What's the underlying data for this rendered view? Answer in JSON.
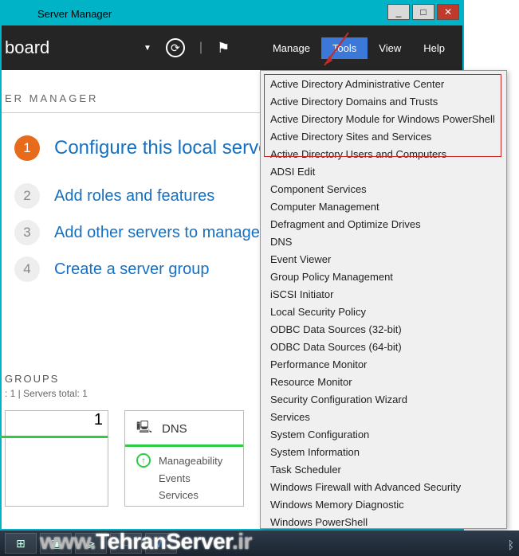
{
  "titlebar": {
    "title": "Server Manager"
  },
  "wincontrols": {
    "min": "_",
    "max": "□",
    "close": "✕"
  },
  "header2": {
    "left_text": "board",
    "menu": {
      "manage": "Manage",
      "tools": "Tools",
      "view": "View",
      "help": "Help"
    }
  },
  "panel": {
    "title": "ER MANAGER"
  },
  "quickstart": {
    "r1": {
      "num": "1",
      "text": "Configure this local server"
    },
    "r2": {
      "num": "2",
      "text": "Add roles and features"
    },
    "r3": {
      "num": "3",
      "text": "Add other servers to manage"
    },
    "r4": {
      "num": "4",
      "text": "Create a server group"
    }
  },
  "groups": {
    "label": "GROUPS",
    "sub": ": 1   |   Servers total: 1"
  },
  "tiles": {
    "a": {
      "count": "1"
    },
    "b": {
      "title": "DNS",
      "l1": "Manageability",
      "l2": "Events",
      "l3": "Services"
    }
  },
  "tools_menu": {
    "items": [
      "Active Directory Administrative Center",
      "Active Directory Domains and Trusts",
      "Active Directory Module for Windows PowerShell",
      "Active Directory Sites and Services",
      "Active Directory Users and Computers",
      "ADSI Edit",
      "Component Services",
      "Computer Management",
      "Defragment and Optimize Drives",
      "DNS",
      "Event Viewer",
      "Group Policy Management",
      "iSCSI Initiator",
      "Local Security Policy",
      "ODBC Data Sources (32-bit)",
      "ODBC Data Sources (64-bit)",
      "Performance Monitor",
      "Resource Monitor",
      "Security Configuration Wizard",
      "Services",
      "System Configuration",
      "System Information",
      "Task Scheduler",
      "Windows Firewall with Advanced Security",
      "Windows Memory Diagnostic",
      "Windows PowerShell"
    ]
  },
  "watermark": {
    "pre": "www.",
    "main": "TehranServer",
    "suf": ".ir"
  },
  "tray": {
    "bt": "ᛒ"
  }
}
